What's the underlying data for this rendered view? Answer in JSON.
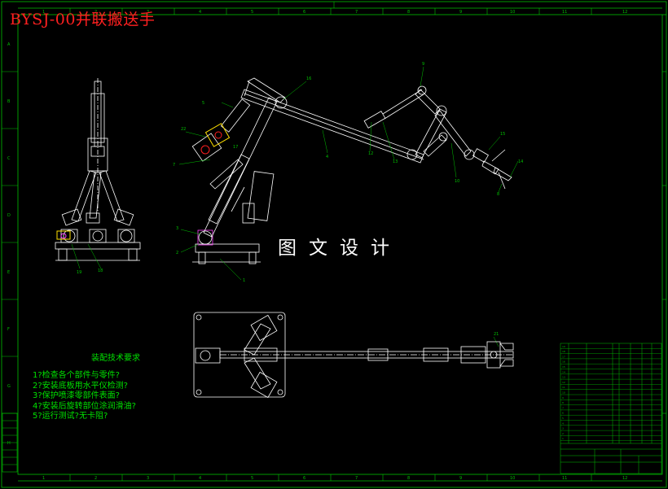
{
  "title": "BYSJ-00并联搬送手",
  "watermark": "图文设计",
  "requirements": {
    "heading": "装配技术要求",
    "items": [
      "1?检查各个部件与零件?",
      "2?安装底板用水平仪检测?",
      "3?保护喷漆零部件表面?",
      "4?安装后旋转部位涂润滑油?",
      "5?运行测试?无卡阻?"
    ]
  },
  "border": {
    "top_numbers": [
      "1",
      "2",
      "3",
      "4",
      "5",
      "6",
      "7",
      "8",
      "9",
      "10",
      "11",
      "12"
    ],
    "side_letters": [
      "A",
      "B",
      "C",
      "D",
      "E",
      "F",
      "G",
      "H"
    ]
  },
  "part_numbers": [
    "1",
    "2",
    "3",
    "4",
    "5",
    "6",
    "7",
    "8",
    "9",
    "10",
    "11",
    "12",
    "13",
    "14",
    "15",
    "16",
    "17",
    "18",
    "19",
    "20",
    "21",
    "22",
    "23",
    "24",
    "25",
    "26"
  ],
  "colors": {
    "frame": "#00c000",
    "lines": "#ffffff",
    "title": "#ff2020",
    "highlight": "#ffe000",
    "accent": "#ff40ff"
  }
}
